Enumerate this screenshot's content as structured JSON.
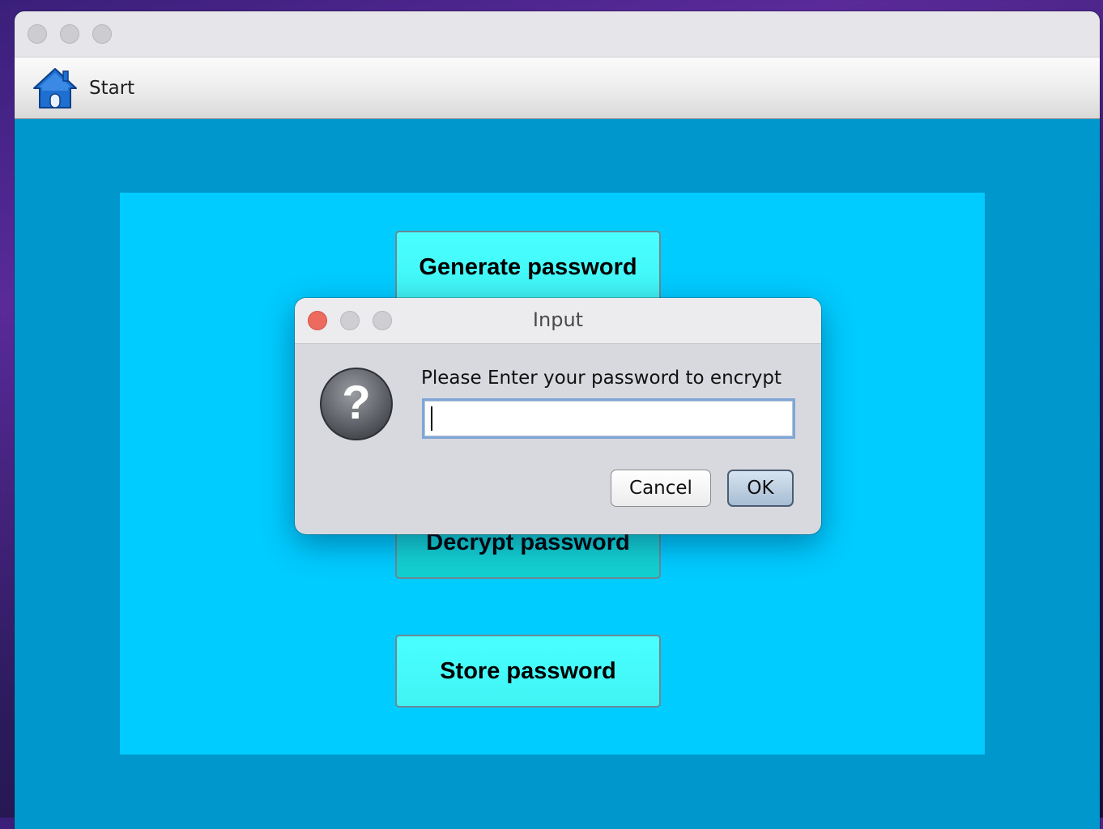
{
  "window": {
    "toolbar": {
      "start_label": "Start",
      "start_icon": "home-icon"
    }
  },
  "main": {
    "buttons": {
      "generate": "Generate password",
      "decrypt": "Decrypt password",
      "store": "Store password"
    }
  },
  "dialog": {
    "title": "Input",
    "message": "Please Enter your password to encrypt",
    "input_value": "",
    "cancel_label": "Cancel",
    "ok_label": "OK",
    "icon": "question-icon"
  },
  "colors": {
    "content_bg": "#0097cc",
    "panel_bg": "#00ccff",
    "button_bg": "#4affff",
    "close_red": "#ed6a5e"
  }
}
